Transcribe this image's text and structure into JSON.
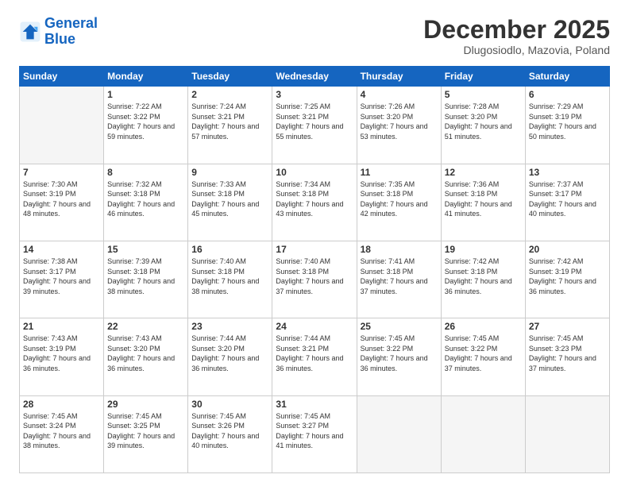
{
  "logo": {
    "line1": "General",
    "line2": "Blue"
  },
  "title": "December 2025",
  "subtitle": "Dlugosiodlo, Mazovia, Poland",
  "days_header": [
    "Sunday",
    "Monday",
    "Tuesday",
    "Wednesday",
    "Thursday",
    "Friday",
    "Saturday"
  ],
  "weeks": [
    [
      {
        "day": "",
        "empty": true
      },
      {
        "day": "1",
        "sunrise": "Sunrise: 7:22 AM",
        "sunset": "Sunset: 3:22 PM",
        "daylight": "Daylight: 7 hours and 59 minutes."
      },
      {
        "day": "2",
        "sunrise": "Sunrise: 7:24 AM",
        "sunset": "Sunset: 3:21 PM",
        "daylight": "Daylight: 7 hours and 57 minutes."
      },
      {
        "day": "3",
        "sunrise": "Sunrise: 7:25 AM",
        "sunset": "Sunset: 3:21 PM",
        "daylight": "Daylight: 7 hours and 55 minutes."
      },
      {
        "day": "4",
        "sunrise": "Sunrise: 7:26 AM",
        "sunset": "Sunset: 3:20 PM",
        "daylight": "Daylight: 7 hours and 53 minutes."
      },
      {
        "day": "5",
        "sunrise": "Sunrise: 7:28 AM",
        "sunset": "Sunset: 3:20 PM",
        "daylight": "Daylight: 7 hours and 51 minutes."
      },
      {
        "day": "6",
        "sunrise": "Sunrise: 7:29 AM",
        "sunset": "Sunset: 3:19 PM",
        "daylight": "Daylight: 7 hours and 50 minutes."
      }
    ],
    [
      {
        "day": "7",
        "sunrise": "Sunrise: 7:30 AM",
        "sunset": "Sunset: 3:19 PM",
        "daylight": "Daylight: 7 hours and 48 minutes."
      },
      {
        "day": "8",
        "sunrise": "Sunrise: 7:32 AM",
        "sunset": "Sunset: 3:18 PM",
        "daylight": "Daylight: 7 hours and 46 minutes."
      },
      {
        "day": "9",
        "sunrise": "Sunrise: 7:33 AM",
        "sunset": "Sunset: 3:18 PM",
        "daylight": "Daylight: 7 hours and 45 minutes."
      },
      {
        "day": "10",
        "sunrise": "Sunrise: 7:34 AM",
        "sunset": "Sunset: 3:18 PM",
        "daylight": "Daylight: 7 hours and 43 minutes."
      },
      {
        "day": "11",
        "sunrise": "Sunrise: 7:35 AM",
        "sunset": "Sunset: 3:18 PM",
        "daylight": "Daylight: 7 hours and 42 minutes."
      },
      {
        "day": "12",
        "sunrise": "Sunrise: 7:36 AM",
        "sunset": "Sunset: 3:18 PM",
        "daylight": "Daylight: 7 hours and 41 minutes."
      },
      {
        "day": "13",
        "sunrise": "Sunrise: 7:37 AM",
        "sunset": "Sunset: 3:17 PM",
        "daylight": "Daylight: 7 hours and 40 minutes."
      }
    ],
    [
      {
        "day": "14",
        "sunrise": "Sunrise: 7:38 AM",
        "sunset": "Sunset: 3:17 PM",
        "daylight": "Daylight: 7 hours and 39 minutes."
      },
      {
        "day": "15",
        "sunrise": "Sunrise: 7:39 AM",
        "sunset": "Sunset: 3:18 PM",
        "daylight": "Daylight: 7 hours and 38 minutes."
      },
      {
        "day": "16",
        "sunrise": "Sunrise: 7:40 AM",
        "sunset": "Sunset: 3:18 PM",
        "daylight": "Daylight: 7 hours and 38 minutes."
      },
      {
        "day": "17",
        "sunrise": "Sunrise: 7:40 AM",
        "sunset": "Sunset: 3:18 PM",
        "daylight": "Daylight: 7 hours and 37 minutes."
      },
      {
        "day": "18",
        "sunrise": "Sunrise: 7:41 AM",
        "sunset": "Sunset: 3:18 PM",
        "daylight": "Daylight: 7 hours and 37 minutes."
      },
      {
        "day": "19",
        "sunrise": "Sunrise: 7:42 AM",
        "sunset": "Sunset: 3:18 PM",
        "daylight": "Daylight: 7 hours and 36 minutes."
      },
      {
        "day": "20",
        "sunrise": "Sunrise: 7:42 AM",
        "sunset": "Sunset: 3:19 PM",
        "daylight": "Daylight: 7 hours and 36 minutes."
      }
    ],
    [
      {
        "day": "21",
        "sunrise": "Sunrise: 7:43 AM",
        "sunset": "Sunset: 3:19 PM",
        "daylight": "Daylight: 7 hours and 36 minutes."
      },
      {
        "day": "22",
        "sunrise": "Sunrise: 7:43 AM",
        "sunset": "Sunset: 3:20 PM",
        "daylight": "Daylight: 7 hours and 36 minutes."
      },
      {
        "day": "23",
        "sunrise": "Sunrise: 7:44 AM",
        "sunset": "Sunset: 3:20 PM",
        "daylight": "Daylight: 7 hours and 36 minutes."
      },
      {
        "day": "24",
        "sunrise": "Sunrise: 7:44 AM",
        "sunset": "Sunset: 3:21 PM",
        "daylight": "Daylight: 7 hours and 36 minutes."
      },
      {
        "day": "25",
        "sunrise": "Sunrise: 7:45 AM",
        "sunset": "Sunset: 3:22 PM",
        "daylight": "Daylight: 7 hours and 36 minutes."
      },
      {
        "day": "26",
        "sunrise": "Sunrise: 7:45 AM",
        "sunset": "Sunset: 3:22 PM",
        "daylight": "Daylight: 7 hours and 37 minutes."
      },
      {
        "day": "27",
        "sunrise": "Sunrise: 7:45 AM",
        "sunset": "Sunset: 3:23 PM",
        "daylight": "Daylight: 7 hours and 37 minutes."
      }
    ],
    [
      {
        "day": "28",
        "sunrise": "Sunrise: 7:45 AM",
        "sunset": "Sunset: 3:24 PM",
        "daylight": "Daylight: 7 hours and 38 minutes."
      },
      {
        "day": "29",
        "sunrise": "Sunrise: 7:45 AM",
        "sunset": "Sunset: 3:25 PM",
        "daylight": "Daylight: 7 hours and 39 minutes."
      },
      {
        "day": "30",
        "sunrise": "Sunrise: 7:45 AM",
        "sunset": "Sunset: 3:26 PM",
        "daylight": "Daylight: 7 hours and 40 minutes."
      },
      {
        "day": "31",
        "sunrise": "Sunrise: 7:45 AM",
        "sunset": "Sunset: 3:27 PM",
        "daylight": "Daylight: 7 hours and 41 minutes."
      },
      {
        "day": "",
        "empty": true
      },
      {
        "day": "",
        "empty": true
      },
      {
        "day": "",
        "empty": true
      }
    ]
  ]
}
